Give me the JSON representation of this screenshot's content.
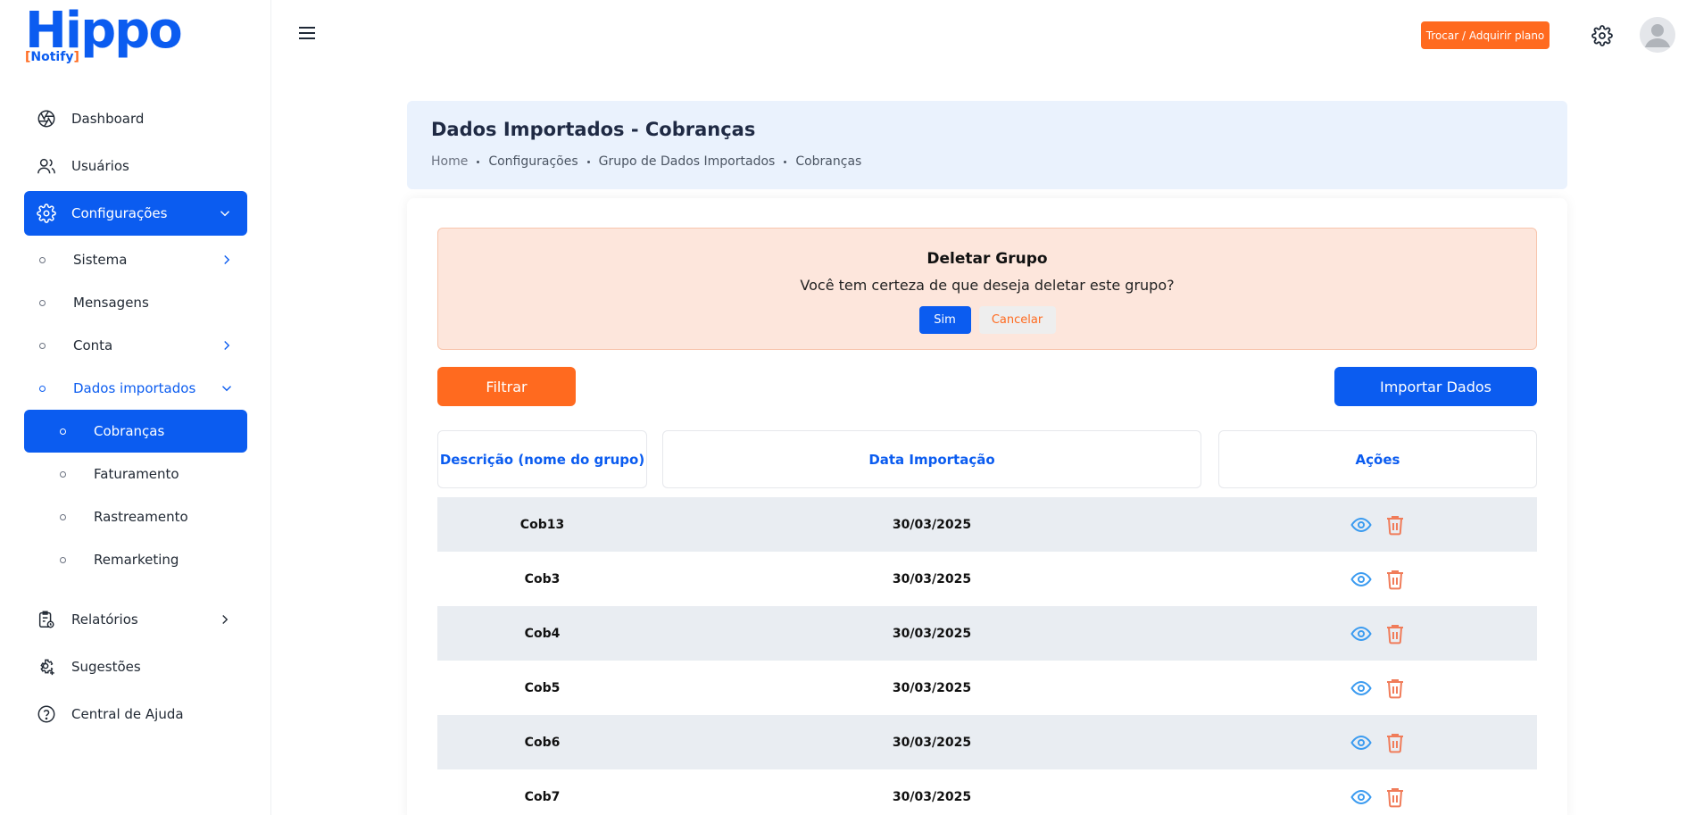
{
  "brand": {
    "name": "Hippo",
    "sub_open": "[",
    "sub": "Notify",
    "sub_close": "]",
    "primary": "#0b5cf0",
    "accent": "#ff6a1f"
  },
  "sidebar": {
    "items": [
      {
        "label": "Dashboard",
        "icon": "aperture-icon"
      },
      {
        "label": "Usuários",
        "icon": "users-icon"
      },
      {
        "label": "Configurações",
        "icon": "gear-icon"
      }
    ],
    "config_sub": [
      {
        "label": "Sistema"
      },
      {
        "label": "Mensagens"
      },
      {
        "label": "Conta"
      },
      {
        "label": "Dados importados"
      }
    ],
    "dados_sub": [
      {
        "label": "Cobranças"
      },
      {
        "label": "Faturamento"
      },
      {
        "label": "Rastreamento"
      },
      {
        "label": "Remarketing"
      }
    ],
    "bottom": [
      {
        "label": "Relatórios",
        "icon": "report-icon"
      },
      {
        "label": "Sugestões",
        "icon": "gear-plus-icon"
      },
      {
        "label": "Central de Ajuda",
        "icon": "help-icon"
      }
    ]
  },
  "topbar": {
    "plan_label": "Trocar / Adquirir plano"
  },
  "page": {
    "title": "Dados Importados - Cobranças",
    "breadcrumb": [
      "Home",
      "Configurações",
      "Grupo de Dados Importados",
      "Cobranças"
    ]
  },
  "alert": {
    "title": "Deletar Grupo",
    "message": "Você tem certeza de que deseja deletar este grupo?",
    "confirm": "Sim",
    "cancel": "Cancelar"
  },
  "actions": {
    "filter": "Filtrar",
    "import": "Importar Dados"
  },
  "table": {
    "headers": [
      "Descrição (nome do grupo)",
      "Data Importação",
      "Ações"
    ],
    "rows": [
      {
        "desc": "Cob13",
        "date": "30/03/2025"
      },
      {
        "desc": "Cob3",
        "date": "30/03/2025"
      },
      {
        "desc": "Cob4",
        "date": "30/03/2025"
      },
      {
        "desc": "Cob5",
        "date": "30/03/2025"
      },
      {
        "desc": "Cob6",
        "date": "30/03/2025"
      },
      {
        "desc": "Cob7",
        "date": "30/03/2025"
      }
    ]
  }
}
